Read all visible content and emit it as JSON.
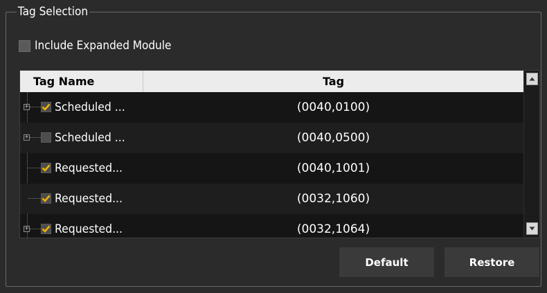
{
  "group": {
    "title": "Tag Selection"
  },
  "include_expanded": {
    "label": "Include Expanded Module",
    "checked": false
  },
  "grid": {
    "headers": {
      "name": "Tag Name",
      "tag": "Tag"
    },
    "rows": [
      {
        "name": "Scheduled ...",
        "tag": "(0040,0100)",
        "checked": true,
        "expandable": true
      },
      {
        "name": "Scheduled ...",
        "tag": "(0040,0500)",
        "checked": false,
        "expandable": true
      },
      {
        "name": "Requested...",
        "tag": "(0040,1001)",
        "checked": true,
        "expandable": false
      },
      {
        "name": "Requested...",
        "tag": "(0032,1060)",
        "checked": true,
        "expandable": false
      },
      {
        "name": "Requested...",
        "tag": "(0032,1064)",
        "checked": true,
        "expandable": true
      }
    ]
  },
  "buttons": {
    "default_label": "Default",
    "restore_label": "Restore"
  },
  "colors": {
    "check_accent": "#f0b400",
    "background": "#2b2b2b",
    "header_bg": "#ececec"
  },
  "icons": {
    "expand": "plus-box-icon",
    "check": "checkmark-icon",
    "scroll_up": "arrow-up-icon",
    "scroll_down": "arrow-down-icon"
  }
}
